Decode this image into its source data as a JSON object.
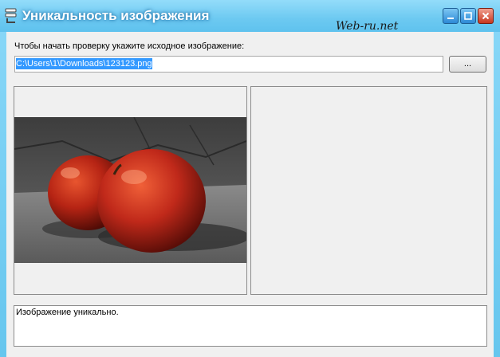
{
  "window": {
    "title": "Уникальность изображения",
    "watermark": "Web-ru.net",
    "icon": "app-icon",
    "controls": {
      "minimize": "minimize-icon",
      "maximize": "maximize-icon",
      "close": "close-icon"
    }
  },
  "form": {
    "prompt": "Чтобы начать проверку укажите исходное изображение:",
    "path_value": "C:\\Users\\1\\Downloads\\123123.png",
    "browse_label": "..."
  },
  "panels": {
    "source_image": "apples-photo",
    "compare_image": ""
  },
  "result": {
    "text": "Изображение уникально."
  },
  "colors": {
    "title_bar": "#6cc9f1",
    "selection": "#3399ff",
    "client_bg": "#f0f0f0"
  }
}
